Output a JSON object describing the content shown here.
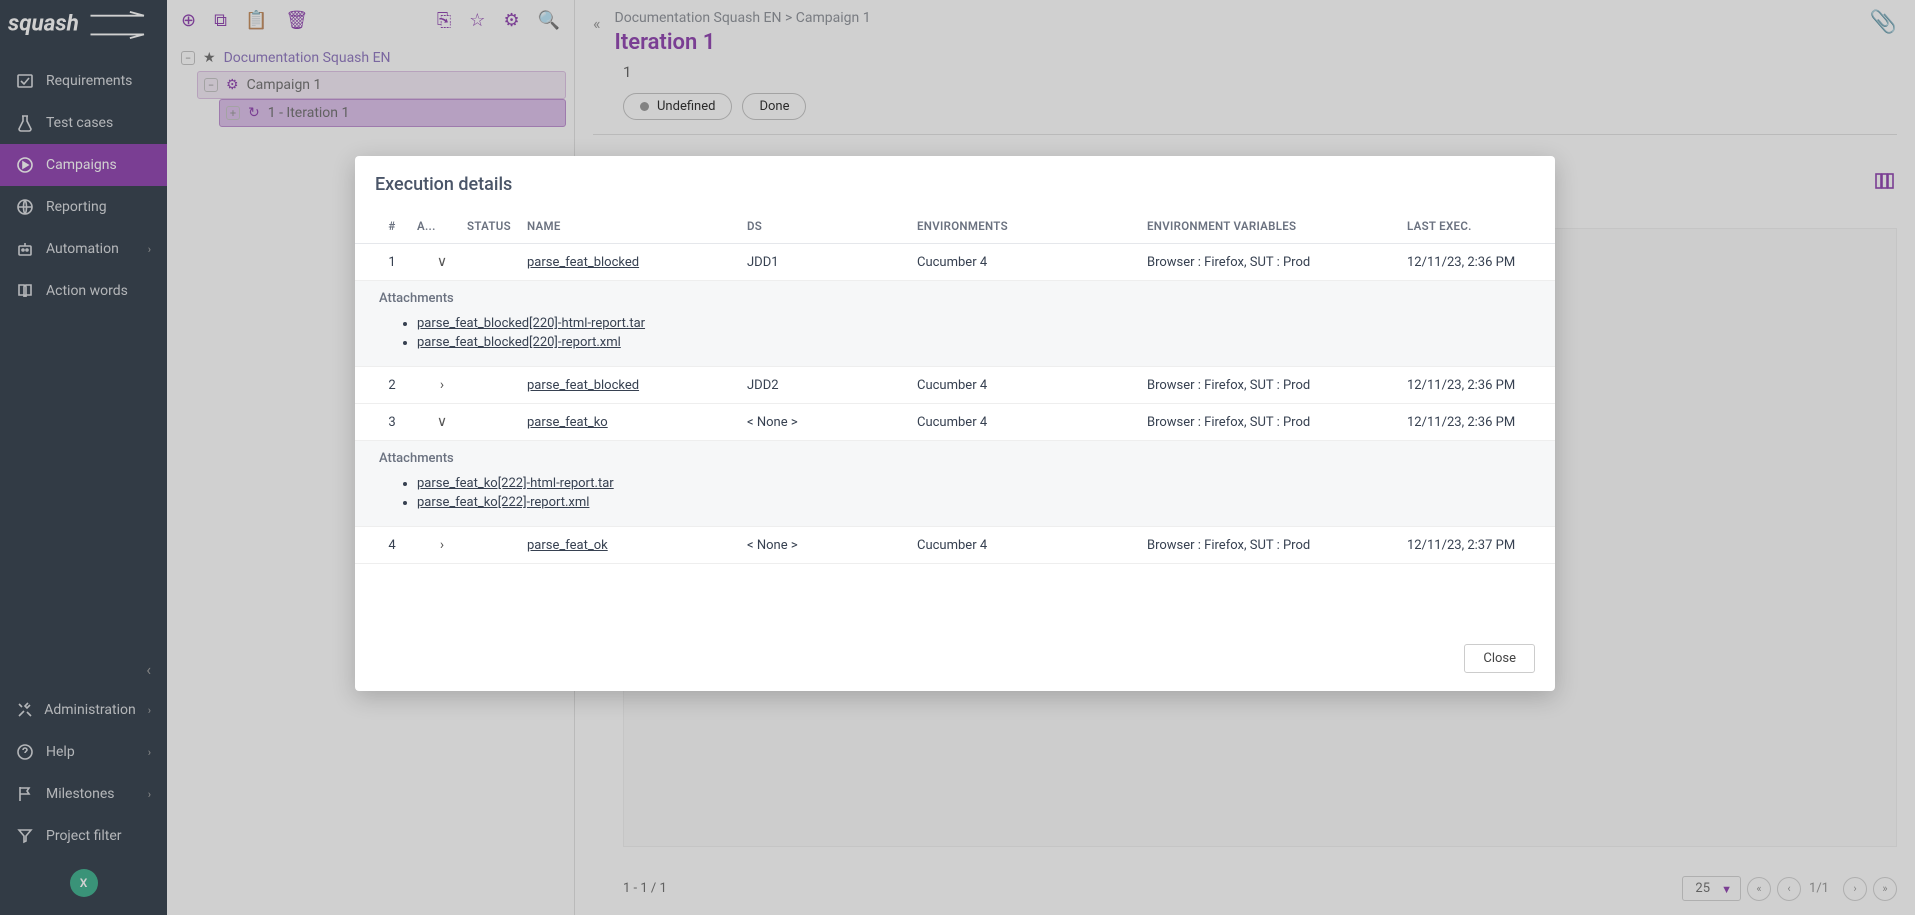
{
  "logo_text": "squash",
  "sidebar": {
    "items": [
      {
        "label": "Requirements"
      },
      {
        "label": "Test cases"
      },
      {
        "label": "Campaigns"
      },
      {
        "label": "Reporting"
      },
      {
        "label": "Automation"
      },
      {
        "label": "Action words"
      }
    ],
    "bottom_items": [
      {
        "label": "Administration"
      },
      {
        "label": "Help"
      },
      {
        "label": "Milestones"
      },
      {
        "label": "Project filter"
      }
    ],
    "user_initial": "X"
  },
  "tree": {
    "root": "Documentation Squash EN",
    "campaign": "Campaign 1",
    "iteration": "1 - Iteration 1"
  },
  "main": {
    "breadcrumb": "Documentation Squash EN > Campaign 1",
    "title": "Iteration 1",
    "row_num": "1",
    "status_undefined": "Undefined",
    "status_done": "Done",
    "footer_range": "1 - 1 / 1",
    "page_size": "25",
    "page_info": "1/1"
  },
  "modal": {
    "title": "Execution details",
    "headers": {
      "num": "#",
      "att": "A...",
      "status": "STATUS",
      "name": "NAME",
      "ds": "DS",
      "env": "ENVIRONMENTS",
      "envvars": "ENVIRONMENT VARIABLES",
      "last": "LAST EXEC."
    },
    "attachments_label": "Attachments",
    "rows": [
      {
        "num": "1",
        "expanded": true,
        "status": "yellow",
        "name": "parse_feat_blocked",
        "ds": "JDD1",
        "env": "Cucumber 4",
        "vars": "Browser : Firefox, SUT : Prod",
        "last": "12/11/23, 2:36 PM",
        "attachments": [
          "parse_feat_blocked[220]-html-report.tar",
          "parse_feat_blocked[220]-report.xml"
        ]
      },
      {
        "num": "2",
        "expanded": false,
        "status": "yellow",
        "name": "parse_feat_blocked",
        "ds": "JDD2",
        "env": "Cucumber 4",
        "vars": "Browser : Firefox, SUT : Prod",
        "last": "12/11/23, 2:36 PM"
      },
      {
        "num": "3",
        "expanded": true,
        "status": "red",
        "name": "parse_feat_ko",
        "ds": "< None >",
        "env": "Cucumber 4",
        "vars": "Browser : Firefox, SUT : Prod",
        "last": "12/11/23, 2:36 PM",
        "attachments": [
          "parse_feat_ko[222]-html-report.tar",
          "parse_feat_ko[222]-report.xml"
        ]
      },
      {
        "num": "4",
        "expanded": false,
        "status": "green",
        "name": "parse_feat_ok",
        "ds": "< None >",
        "env": "Cucumber 4",
        "vars": "Browser : Firefox, SUT : Prod",
        "last": "12/11/23, 2:37 PM"
      }
    ],
    "close": "Close"
  }
}
